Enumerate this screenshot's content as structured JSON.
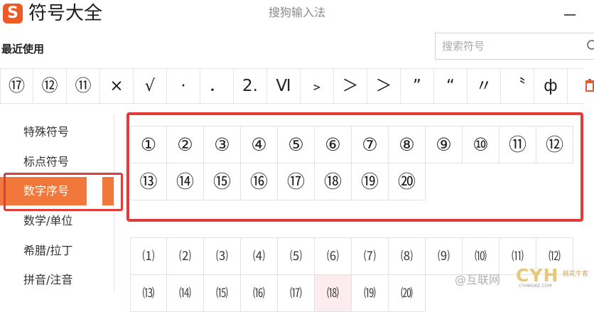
{
  "app": {
    "logo_letter": "S",
    "title": "符号大全",
    "subtitle": "搜狗输入法"
  },
  "recent": {
    "label": "最近使用",
    "symbols": [
      "⑰",
      "⑫",
      "⑪",
      "×",
      "√",
      "·",
      "．",
      "2.",
      "Ⅵ",
      "﹥",
      "＞",
      "＞",
      "”",
      "“",
      "〃",
      "〝",
      "ф"
    ]
  },
  "search": {
    "placeholder": "搜索符号"
  },
  "sidebar": {
    "items": [
      {
        "label": "特殊符号",
        "active": false
      },
      {
        "label": "标点符号",
        "active": false
      },
      {
        "label": "数字序号",
        "active": true
      },
      {
        "label": "数学/单位",
        "active": false
      },
      {
        "label": "希腊/拉丁",
        "active": false
      },
      {
        "label": "拼音/注音",
        "active": false
      }
    ]
  },
  "circled_numbers": [
    "①",
    "②",
    "③",
    "④",
    "⑤",
    "⑥",
    "⑦",
    "⑧",
    "⑨",
    "⑩",
    "⑪",
    "⑫",
    "⑬",
    "⑭",
    "⑮",
    "⑯",
    "⑰",
    "⑱",
    "⑲",
    "⑳"
  ],
  "parenthesized_numbers": [
    "⑴",
    "⑵",
    "⑶",
    "⑷",
    "⑸",
    "⑹",
    "⑺",
    "⑻",
    "⑼",
    "⑽",
    "⑾",
    "⑿",
    "⒀",
    "⒁",
    "⒂",
    "⒃",
    "⒄",
    "⒅",
    "⒆",
    "⒇"
  ],
  "watermark": {
    "text": "@互联网",
    "brand": "CYH",
    "small": "CYHNIUKE.COM",
    "side": "桃花牛客"
  },
  "colors": {
    "accent": "#f2773a",
    "highlight_border": "#e03c3c",
    "logo": "#f05a22"
  }
}
